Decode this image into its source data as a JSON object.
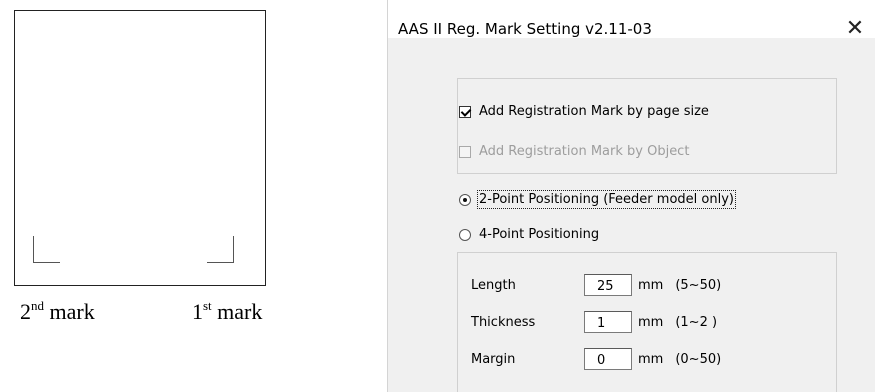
{
  "illustration": {
    "second_mark": {
      "ordinal": "2",
      "suffix": "nd",
      "word": "mark"
    },
    "first_mark": {
      "ordinal": "1",
      "suffix": "st",
      "word": "mark"
    }
  },
  "dialog": {
    "title": "AAS II Reg. Mark Setting v2.11-03",
    "close_glyph": "✕",
    "checkboxes": [
      {
        "label": "Add Registration Mark by page size",
        "checked": true,
        "enabled": true
      },
      {
        "label": "Add Registration Mark by Object",
        "checked": false,
        "enabled": false
      }
    ],
    "positioning": [
      {
        "label": "2-Point Positioning (Feeder model only)",
        "selected": true
      },
      {
        "label": "4-Point Positioning",
        "selected": false
      }
    ],
    "params": [
      {
        "label": "Length",
        "value": "25",
        "unit": "mm",
        "range": "(5~50)"
      },
      {
        "label": "Thickness",
        "value": "1",
        "unit": "mm",
        "range": "(1~2 )"
      },
      {
        "label": "Margin",
        "value": "0",
        "unit": "mm",
        "range": "(0~50)"
      }
    ]
  }
}
